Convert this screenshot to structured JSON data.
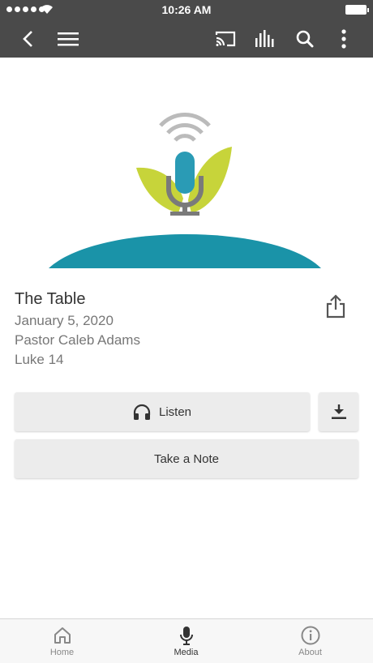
{
  "status_bar": {
    "time": "10:26 AM"
  },
  "nav": {
    "icons": [
      "back-icon",
      "menu-icon",
      "cast-icon",
      "audio-bars-icon",
      "search-icon",
      "more-vert-icon"
    ]
  },
  "sermon": {
    "title": "The Table",
    "date": "January 5, 2020",
    "speaker": "Pastor Caleb Adams",
    "passage": "Luke 14"
  },
  "actions": {
    "listen_label": "Listen",
    "note_label": "Take a Note"
  },
  "tabs": [
    {
      "label": "Home",
      "icon": "home-icon",
      "active": false
    },
    {
      "label": "Media",
      "icon": "microphone-icon",
      "active": true
    },
    {
      "label": "About",
      "icon": "info-icon",
      "active": false
    }
  ],
  "colors": {
    "bar": "#4a4a4a",
    "teal": "#1a93a8",
    "leaf": "#c7d43a",
    "mic": "#2a9bb5",
    "button": "#ececec"
  }
}
